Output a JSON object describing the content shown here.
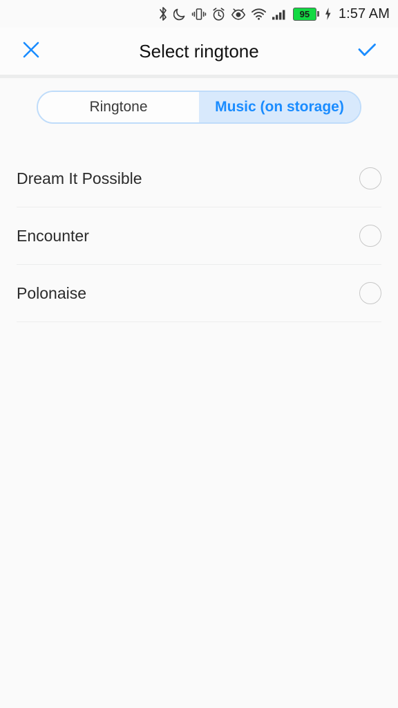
{
  "statusbar": {
    "icons": [
      {
        "name": "bluetooth-icon",
        "label": "bluetooth"
      },
      {
        "name": "do-not-disturb-icon",
        "label": "do not disturb"
      },
      {
        "name": "vibrate-icon",
        "label": "vibrate"
      },
      {
        "name": "alarm-icon",
        "label": "alarm"
      },
      {
        "name": "eye-care-icon",
        "label": "eye protection"
      },
      {
        "name": "wifi-icon",
        "label": "wifi"
      },
      {
        "name": "signal-icon",
        "label": "cellular signal"
      }
    ],
    "battery_level": "95",
    "battery_charging": true,
    "battery_color": "#12d943",
    "time": "1:57 AM"
  },
  "header": {
    "close_label": "close",
    "title": "Select ringtone",
    "confirm_label": "confirm",
    "accent_color": "#1a8cff"
  },
  "tabs": [
    {
      "label": "Ringtone",
      "active": false
    },
    {
      "label": "Music (on storage)",
      "active": true
    }
  ],
  "list": {
    "items": [
      {
        "label": "Dream It Possible",
        "selected": false
      },
      {
        "label": "Encounter",
        "selected": false
      },
      {
        "label": "Polonaise",
        "selected": false
      }
    ]
  }
}
